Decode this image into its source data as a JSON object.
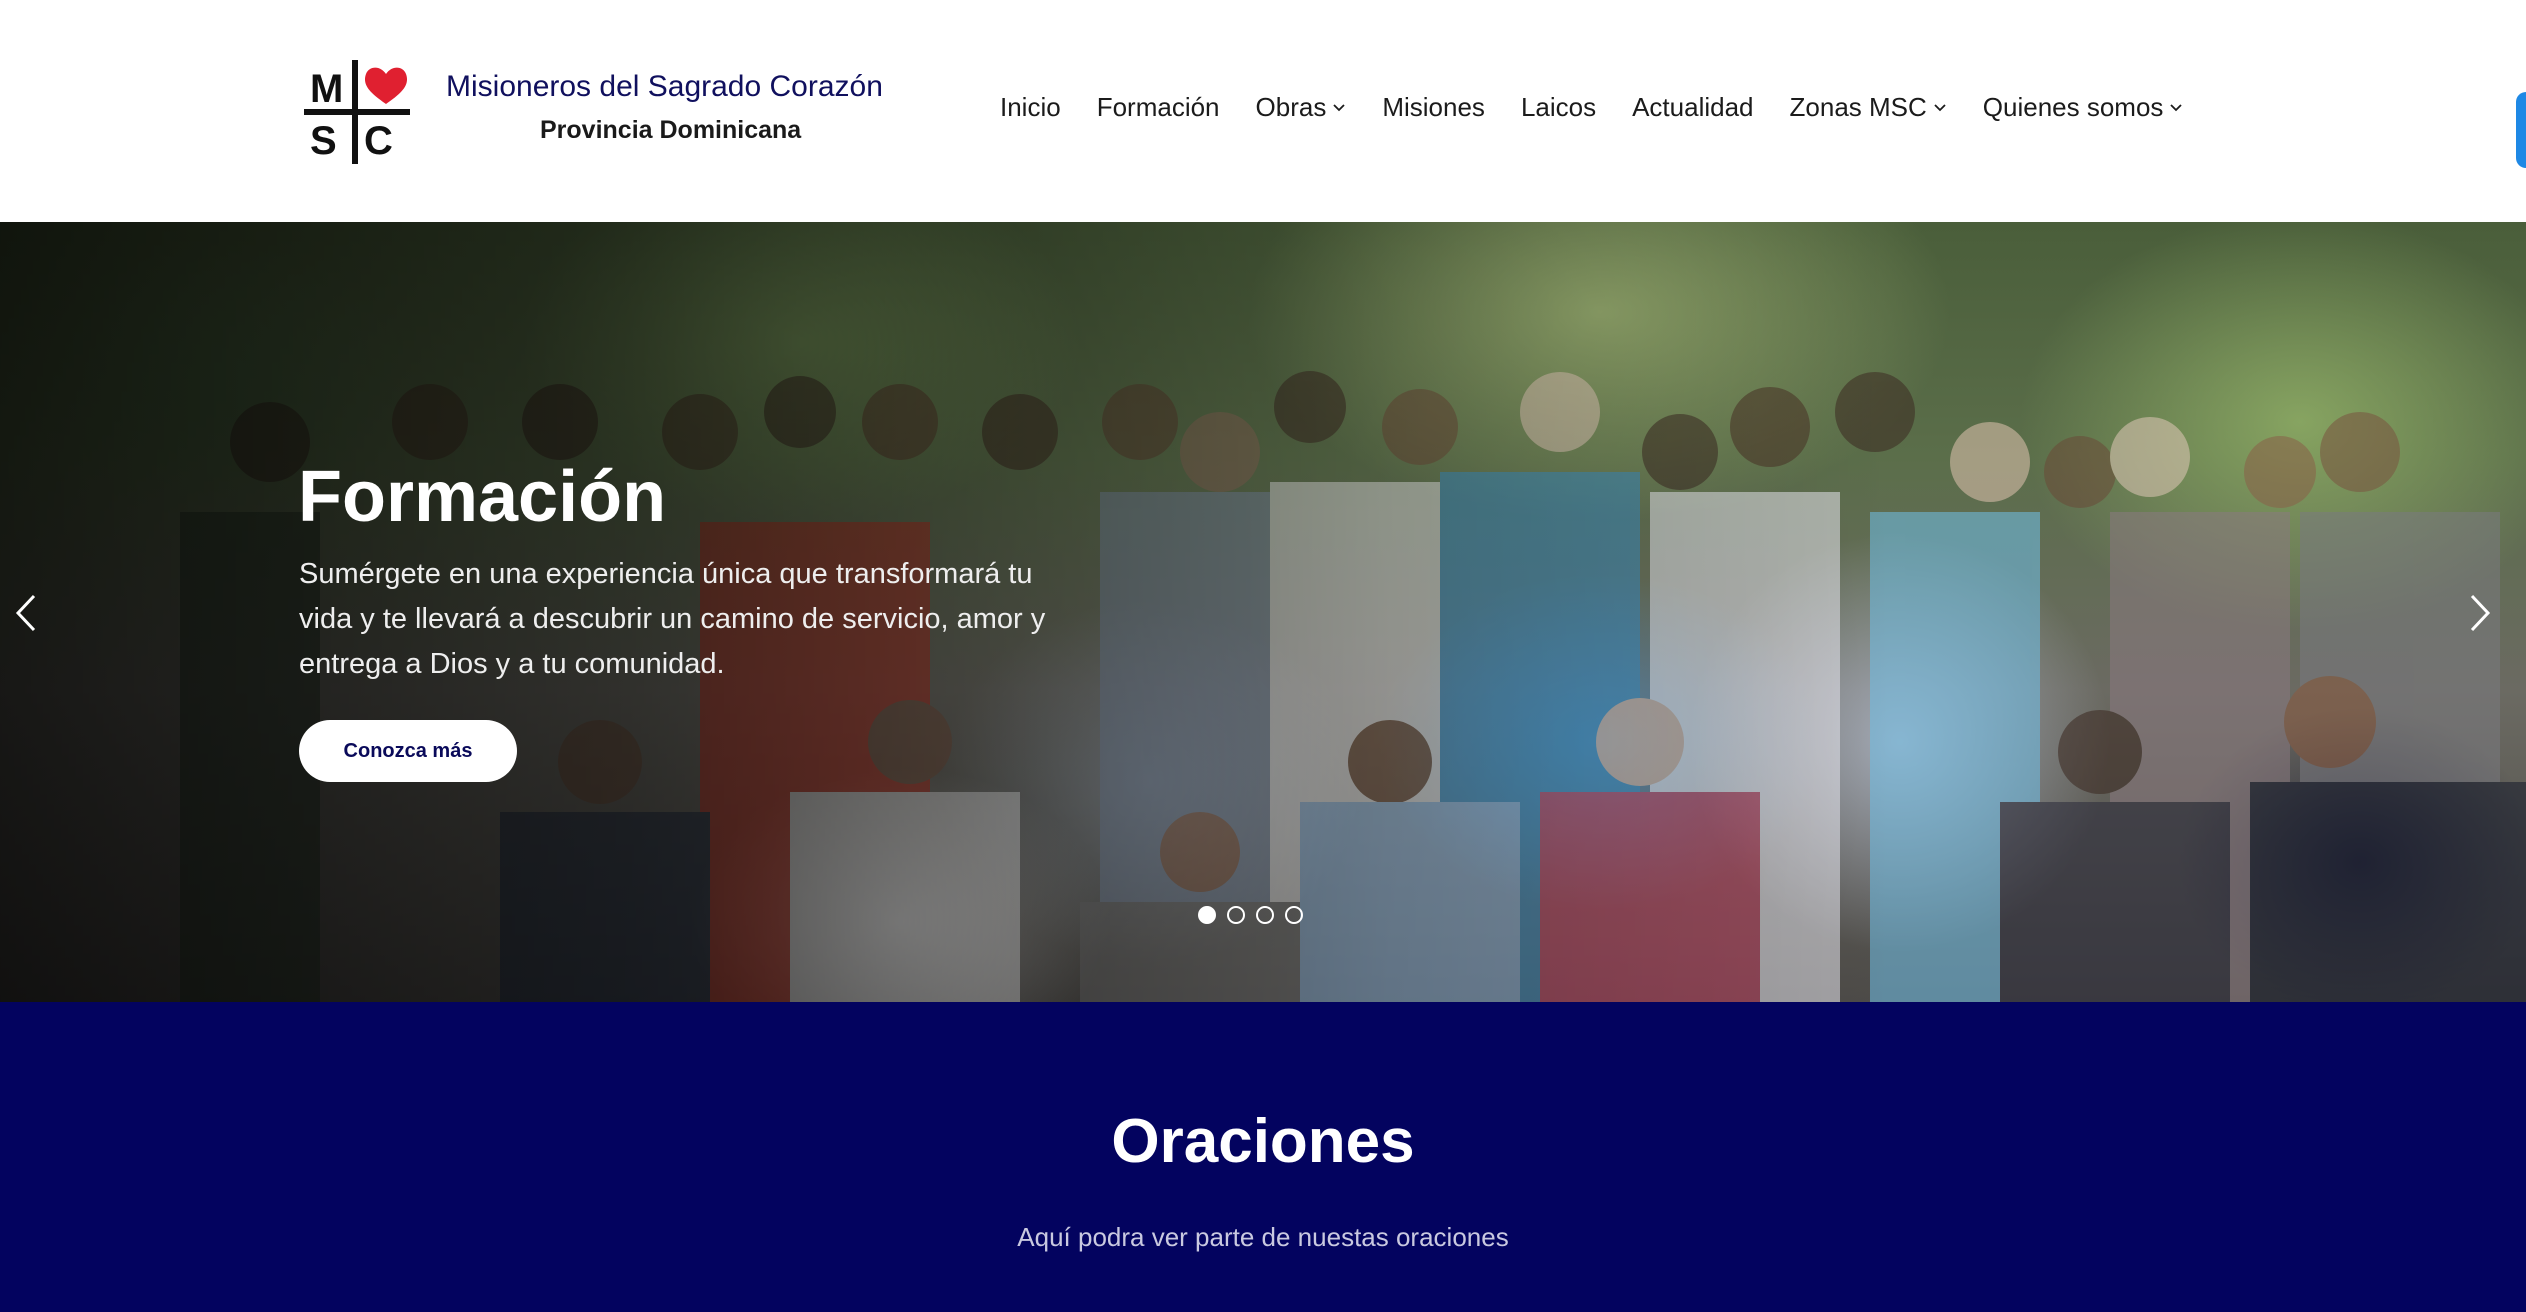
{
  "brand": {
    "title": "Misioneros del Sagrado Corazón",
    "subtitle": "Provincia Dominicana",
    "logo_letters": [
      "M",
      "S",
      "C"
    ],
    "colors": {
      "navy": "#10105e",
      "heart": "#e02030"
    }
  },
  "nav": {
    "items": [
      {
        "label": "Inicio",
        "dropdown": false
      },
      {
        "label": "Formación",
        "dropdown": false
      },
      {
        "label": "Obras",
        "dropdown": true
      },
      {
        "label": "Misiones",
        "dropdown": false
      },
      {
        "label": "Laicos",
        "dropdown": false
      },
      {
        "label": "Actualidad",
        "dropdown": false
      },
      {
        "label": "Zonas MSC",
        "dropdown": true
      },
      {
        "label": "Quienes somos",
        "dropdown": true
      }
    ]
  },
  "hero": {
    "title": "Formación",
    "text": "Sumérgete en una experiencia única que transformará tu vida y te llevará a descubrir un camino de servicio, amor y entrega a Dios y a tu comunidad.",
    "button_label": "Conozca más",
    "slide_count": 4,
    "active_slide": 1
  },
  "prayers": {
    "title": "Oraciones",
    "subtitle": "Aquí podra ver parte de nuestas oraciones",
    "background": "#03035f"
  }
}
